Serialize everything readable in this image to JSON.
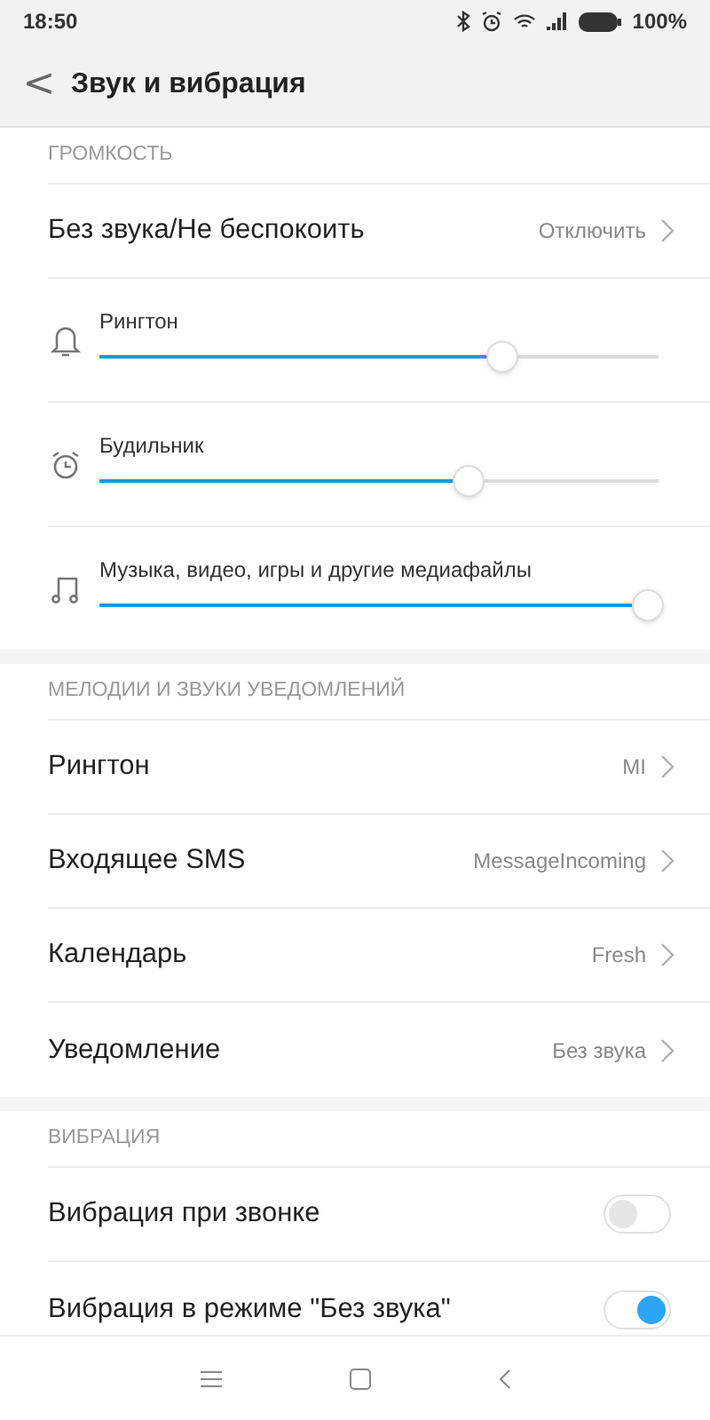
{
  "status_bar": {
    "time": "18:50",
    "battery": "100%"
  },
  "header": {
    "back": "<",
    "title": "Звук и вибрация"
  },
  "sections": [
    {
      "title": "ГРОМКОСТЬ",
      "items": [
        {
          "kind": "link",
          "label": "Без звука/Не беспокоить",
          "value": "Отключить"
        },
        {
          "kind": "slider",
          "label": "Рингтон",
          "level": 0.72
        },
        {
          "kind": "slider",
          "label": "Будильник",
          "level": 0.66
        },
        {
          "kind": "slider",
          "label": "Музыка, видео, игры и другие медиафайлы",
          "level": 0.98
        }
      ]
    },
    {
      "title": "МЕЛОДИИ И ЗВУКИ УВЕДОМЛЕНИЙ",
      "items": [
        {
          "kind": "link",
          "label": "Рингтон",
          "value": "MI"
        },
        {
          "kind": "link",
          "label": "Входящее SMS",
          "value": "MessageIncoming"
        },
        {
          "kind": "link",
          "label": "Календарь",
          "value": "Fresh"
        },
        {
          "kind": "link",
          "label": "Уведомление",
          "value": "Без звука"
        }
      ]
    },
    {
      "title": "ВИБРАЦИЯ",
      "items": [
        {
          "kind": "toggle",
          "label": "Вибрация при звонке",
          "on": false
        },
        {
          "kind": "toggle",
          "label": "Вибрация в режиме \"Без звука\"",
          "on": true
        }
      ]
    }
  ]
}
